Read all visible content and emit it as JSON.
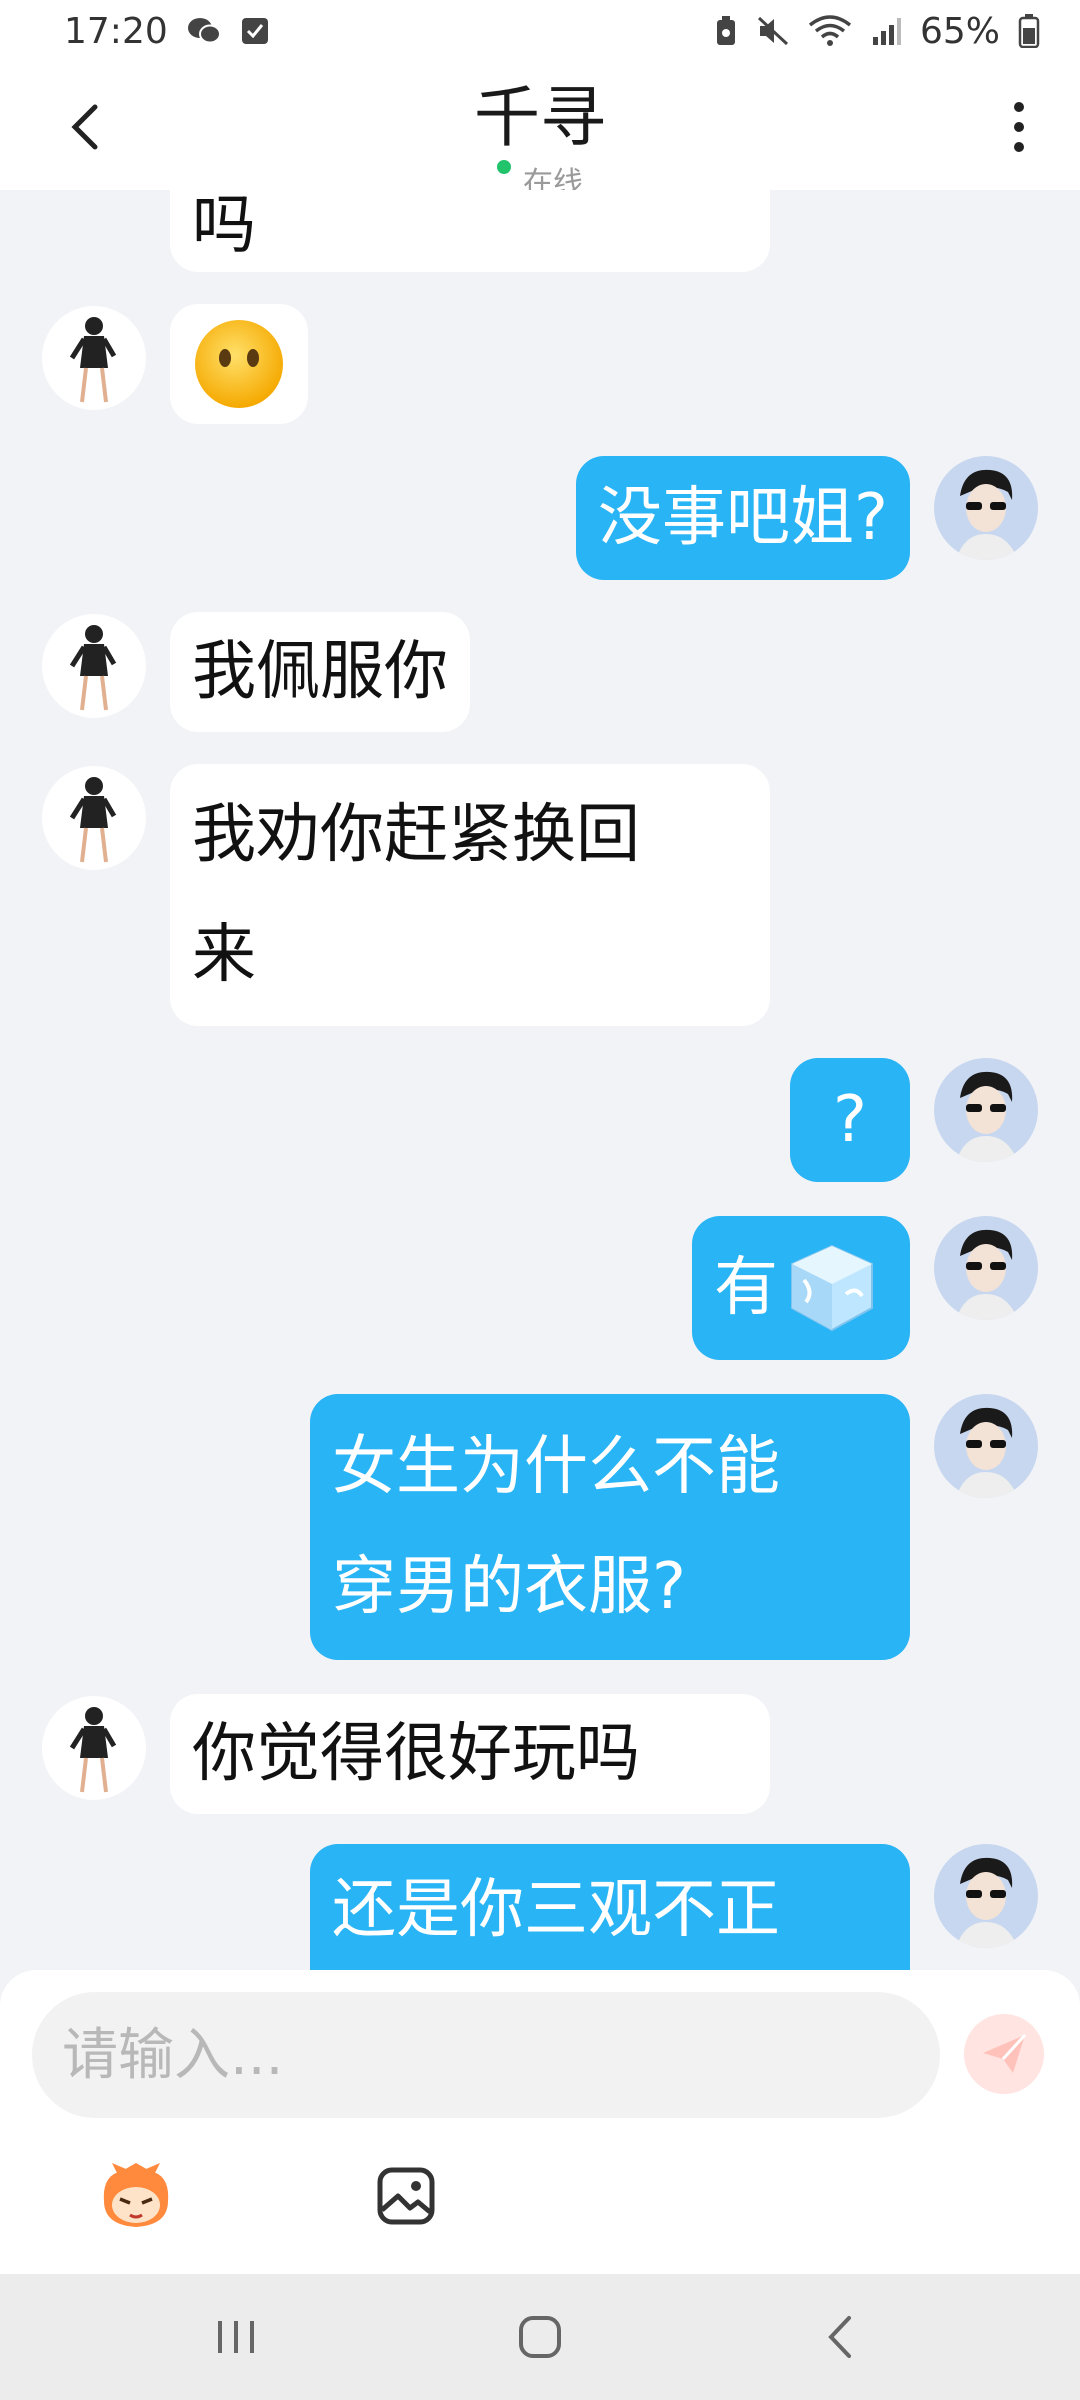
{
  "status_bar": {
    "time": "17:20",
    "battery": "65%",
    "icons": [
      "wechat-icon",
      "check-icon",
      "battery-saver-icon",
      "mute-icon",
      "wifi-icon",
      "signal-icon",
      "battery-icon"
    ]
  },
  "header": {
    "title": "千寻",
    "status": "在线",
    "back_icon": "chevron-left-icon",
    "more_icon": "more-vertical-icon"
  },
  "messages": [
    {
      "side": "in",
      "text": "吗"
    },
    {
      "side": "in",
      "emoji": "neutral-face-emoji"
    },
    {
      "side": "out",
      "text": "没事吧姐?"
    },
    {
      "side": "in",
      "text": "我佩服你"
    },
    {
      "side": "in",
      "lines": [
        "我劝你赶紧换回",
        "来"
      ]
    },
    {
      "side": "out",
      "text": "?"
    },
    {
      "side": "out",
      "text": "有",
      "emoji": "ice-cube-emoji"
    },
    {
      "side": "out",
      "lines": [
        "女生为什么不能",
        "穿男的衣服?"
      ]
    },
    {
      "side": "in",
      "text": "你觉得很好玩吗"
    },
    {
      "side": "out",
      "text": "还是你三观不正"
    }
  ],
  "composer": {
    "placeholder": "请输入...",
    "send_icon": "send-icon",
    "tools": [
      "sticker-mascot-icon",
      "image-icon"
    ]
  },
  "navbar": {
    "buttons": [
      "recent-apps-icon",
      "home-icon",
      "back-icon"
    ]
  },
  "colors": {
    "outgoing_bubble": "#28b4f5",
    "incoming_bubble": "#ffffff",
    "chat_background": "#f2f3f7",
    "online": "#21c46b"
  }
}
